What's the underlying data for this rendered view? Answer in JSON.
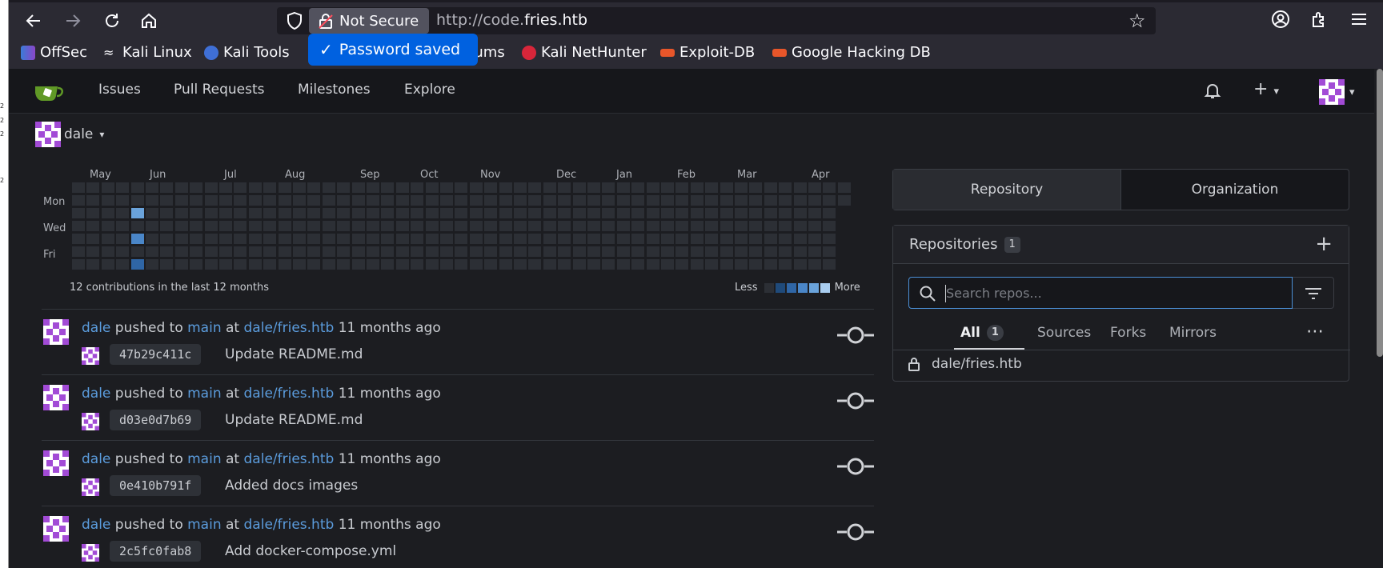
{
  "browser": {
    "security_label": "Not Secure",
    "url_prefix": "http://code.",
    "url_domain": "fries.htb",
    "toast": "Password saved",
    "bookmarks": [
      "OffSec",
      "Kali Linux",
      "Kali Tools",
      "rums",
      "Kali NetHunter",
      "Exploit-DB",
      "Google Hacking DB"
    ]
  },
  "nav": {
    "links": [
      "Issues",
      "Pull Requests",
      "Milestones",
      "Explore"
    ]
  },
  "context": {
    "user": "dale"
  },
  "heatmap": {
    "months": [
      "May",
      "Jun",
      "Jul",
      "Aug",
      "Sep",
      "Oct",
      "Nov",
      "Dec",
      "Jan",
      "Feb",
      "Mar",
      "Apr"
    ],
    "days": [
      "Mon",
      "Wed",
      "Fri"
    ],
    "summary": "12 contributions in the last 12 months",
    "less": "Less",
    "more": "More"
  },
  "feed": [
    {
      "user": "dale",
      "action": "pushed to",
      "branch": "main",
      "at": "at",
      "repo": "dale/fries.htb",
      "time": "11 months ago",
      "sha": "47b29c411c",
      "message": "Update README.md"
    },
    {
      "user": "dale",
      "action": "pushed to",
      "branch": "main",
      "at": "at",
      "repo": "dale/fries.htb",
      "time": "11 months ago",
      "sha": "d03e0d7b69",
      "message": "Update README.md"
    },
    {
      "user": "dale",
      "action": "pushed to",
      "branch": "main",
      "at": "at",
      "repo": "dale/fries.htb",
      "time": "11 months ago",
      "sha": "0e410b791f",
      "message": "Added docs images"
    },
    {
      "user": "dale",
      "action": "pushed to",
      "branch": "main",
      "at": "at",
      "repo": "dale/fries.htb",
      "time": "11 months ago",
      "sha": "2c5fc0fab8",
      "message": "Add docker-compose.yml"
    }
  ],
  "right": {
    "tabs": [
      "Repository",
      "Organization"
    ],
    "repos_title": "Repositories",
    "repos_count": "1",
    "search_placeholder": "Search repos...",
    "filters": [
      "All",
      "Sources",
      "Forks",
      "Mirrors"
    ],
    "all_count": "1",
    "more": "⋯",
    "repo": "dale/fries.htb"
  },
  "colors": {
    "accent": "#5b9cdd",
    "toast": "#0061e0",
    "heat_levels": [
      "#2c2f35",
      "#1f4a7a",
      "#2f66a6",
      "#4a86c8",
      "#6aa3db",
      "#a9cdf0"
    ]
  }
}
